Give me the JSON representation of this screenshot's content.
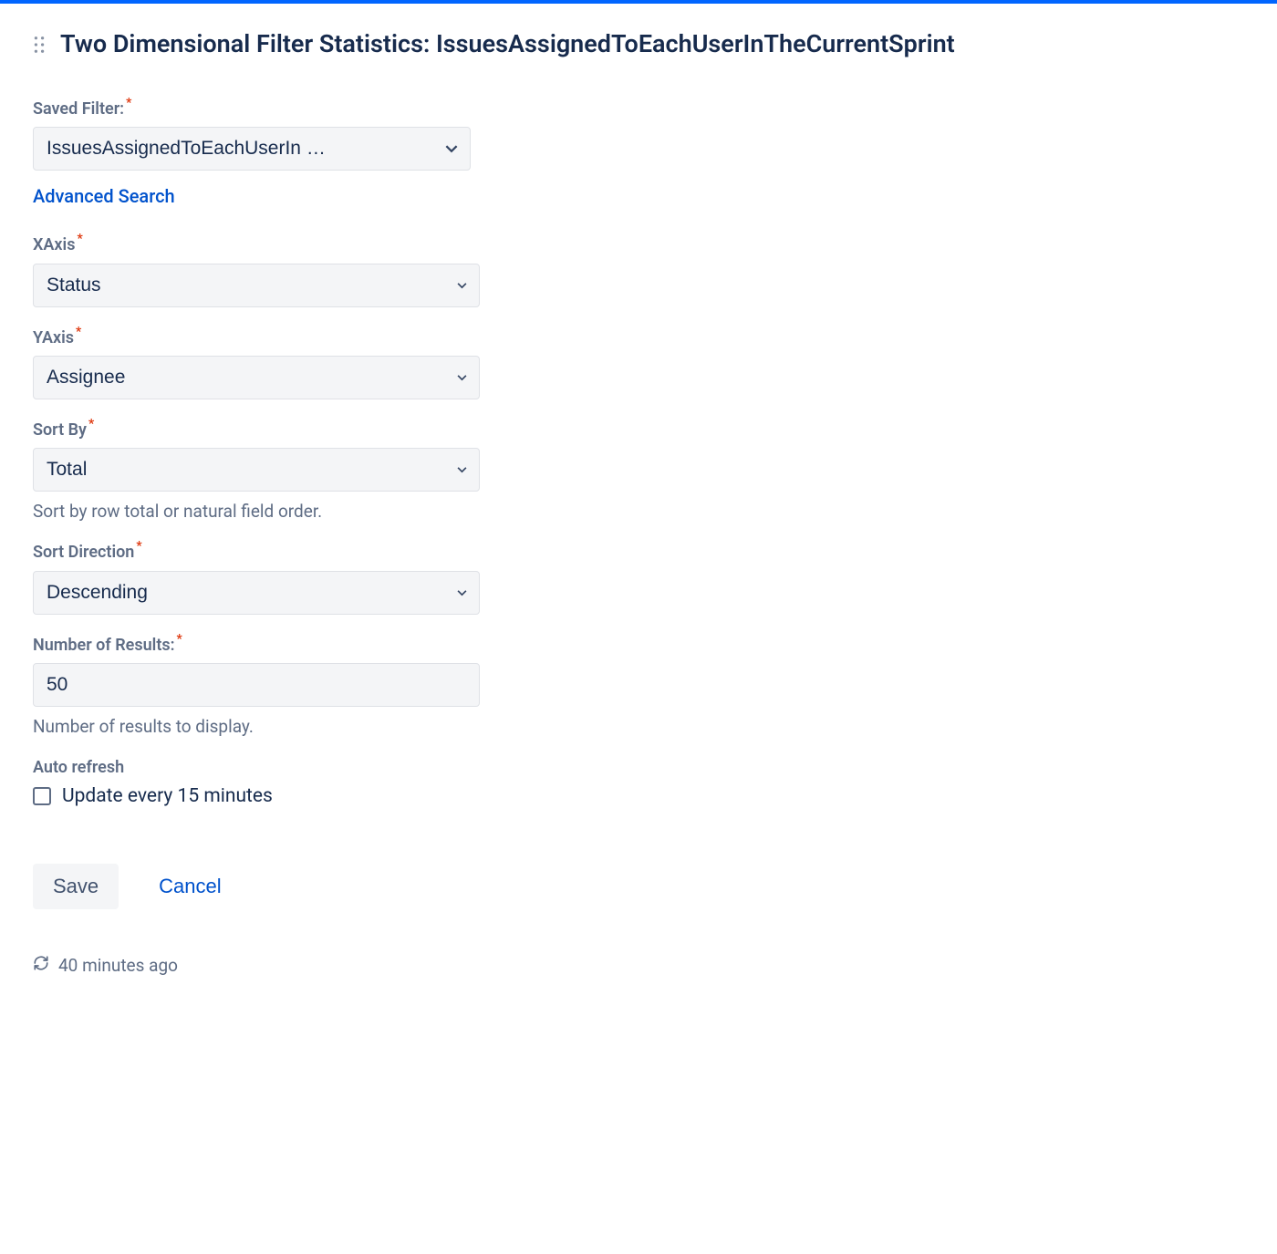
{
  "header": {
    "title": "Two Dimensional Filter Statistics: IssuesAssignedToEachUserInTheCurrentSprint"
  },
  "form": {
    "saved_filter": {
      "label": "Saved Filter:",
      "value": "IssuesAssignedToEachUserIn …",
      "advanced_link": "Advanced Search"
    },
    "xaxis": {
      "label": "XAxis",
      "value": "Status"
    },
    "yaxis": {
      "label": "YAxis",
      "value": "Assignee"
    },
    "sort_by": {
      "label": "Sort By",
      "value": "Total",
      "help": "Sort by row total or natural field order."
    },
    "sort_direction": {
      "label": "Sort Direction",
      "value": "Descending"
    },
    "number_of_results": {
      "label": "Number of Results:",
      "value": "50",
      "help": "Number of results to display."
    },
    "auto_refresh": {
      "label": "Auto refresh",
      "checkbox_label": "Update every 15 minutes"
    }
  },
  "buttons": {
    "save": "Save",
    "cancel": "Cancel"
  },
  "footer": {
    "timestamp": "40 minutes ago"
  }
}
